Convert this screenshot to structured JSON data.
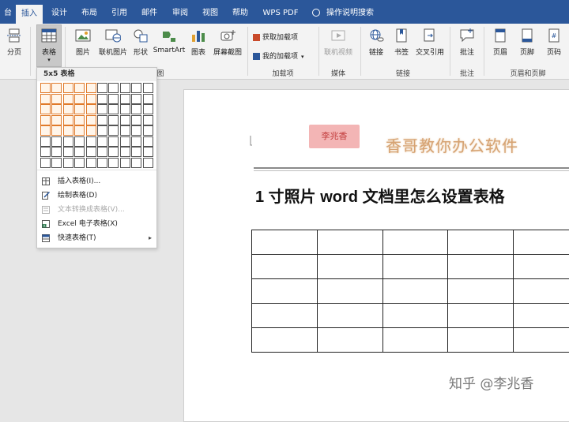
{
  "tabs": [
    {
      "label": "台"
    },
    {
      "label": "插入",
      "active": true
    },
    {
      "label": "设计"
    },
    {
      "label": "布局"
    },
    {
      "label": "引用"
    },
    {
      "label": "邮件"
    },
    {
      "label": "审阅"
    },
    {
      "label": "视图"
    },
    {
      "label": "帮助"
    },
    {
      "label": "WPS PDF"
    }
  ],
  "tell_me": "操作说明搜索",
  "ribbon": {
    "page_break": "分页",
    "table": "表格",
    "picture": "图片",
    "online_picture": "联机图片",
    "shapes": "形状",
    "smartart": "SmartArt",
    "chart": "图表",
    "screenshot": "屏幕截图",
    "get_addins": "获取加载项",
    "my_addins": "我的加载项",
    "online_video": "联机视频",
    "link": "链接",
    "bookmark": "书签",
    "cross_ref": "交叉引用",
    "comment": "批注",
    "header": "页眉",
    "footer": "页脚",
    "page_number": "页码",
    "groups": {
      "illustrations": "图",
      "addins": "加载项",
      "media": "媒体",
      "links": "链接",
      "comments": "批注",
      "header_footer": "页眉和页脚"
    }
  },
  "table_dropdown": {
    "header": "5x5 表格",
    "selected_rows": 5,
    "selected_cols": 5,
    "grid_rows": 8,
    "grid_cols": 10,
    "items": [
      {
        "label": "插入表格(I)...",
        "enabled": true
      },
      {
        "label": "绘制表格(D)",
        "enabled": true
      },
      {
        "label": "文本转换成表格(V)...",
        "enabled": false
      },
      {
        "label": "Excel 电子表格(X)",
        "enabled": true
      },
      {
        "label": "快速表格(T)",
        "enabled": true,
        "submenu": true
      }
    ]
  },
  "document": {
    "stamp_text": "李兆香",
    "brand_text": "香哥教你办公软件",
    "title": "1 寸照片 word 文档里怎么设置表格",
    "table_rows": 5,
    "table_cols": 5
  },
  "watermark": "知乎 @李兆香",
  "colors": {
    "accent": "#2b579a",
    "grid_selected": "#e07a2a",
    "brand_text": "#d6a373"
  }
}
